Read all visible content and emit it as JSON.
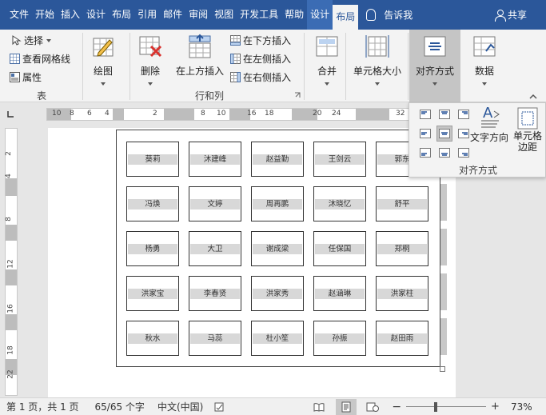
{
  "tabs": [
    {
      "label": "文件",
      "state": "normal"
    },
    {
      "label": "开始",
      "state": "normal"
    },
    {
      "label": "插入",
      "state": "normal"
    },
    {
      "label": "设计",
      "state": "normal"
    },
    {
      "label": "布局",
      "state": "normal"
    },
    {
      "label": "引用",
      "state": "normal"
    },
    {
      "label": "邮件",
      "state": "normal"
    },
    {
      "label": "审阅",
      "state": "normal"
    },
    {
      "label": "视图",
      "state": "normal"
    },
    {
      "label": "开发工具",
      "state": "normal"
    },
    {
      "label": "帮助",
      "state": "normal"
    },
    {
      "label": "设计",
      "state": "context"
    },
    {
      "label": "布局",
      "state": "active"
    }
  ],
  "tell_me": "告诉我",
  "share": "共享",
  "ribbon": {
    "table_group": {
      "select": "选择",
      "view_gridlines": "查看网格线",
      "properties": "属性",
      "label": "表"
    },
    "draw": "绘图",
    "rows_cols_group": {
      "delete": "删除",
      "insert_above": "在上方插入",
      "insert_below": "在下方插入",
      "insert_left": "在左侧插入",
      "insert_right": "在右侧插入",
      "label": "行和列"
    },
    "merge": "合并",
    "cell_size": "单元格大小",
    "alignment": "对齐方式",
    "data": "数据"
  },
  "align_panel": {
    "text_direction": "文字方向",
    "cell_margins_line1": "单元格",
    "cell_margins_line2": "边距",
    "label": "对齐方式"
  },
  "hruler_numbers": [
    "10",
    "8",
    "6",
    "4",
    "2",
    "8",
    "10",
    "16",
    "18",
    "24",
    "20",
    "32"
  ],
  "vruler_numbers": [
    "2",
    "4",
    "8",
    "12",
    "16",
    "18",
    "22"
  ],
  "table_rows": [
    [
      "葵莉",
      "沐建峰",
      "赵益勤",
      "王剑云",
      "郭东"
    ],
    [
      "冯焕",
      "文婷",
      "周再鹏",
      "沐晓忆",
      "舒平"
    ],
    [
      "杨勇",
      "大卫",
      "谢成梁",
      "任保国",
      "郑桐"
    ],
    [
      "洪家宝",
      "李春贤",
      "洪家秀",
      "赵涵琳",
      "洪家柱"
    ],
    [
      "秋水",
      "马蕊",
      "杜小笙",
      "孙振",
      "赵田雨"
    ]
  ],
  "status": {
    "page": "第 1 页，共 1 页",
    "words": "65/65 个字",
    "language": "中文(中国)",
    "zoom": "73%",
    "zoom_level": 0.73
  }
}
